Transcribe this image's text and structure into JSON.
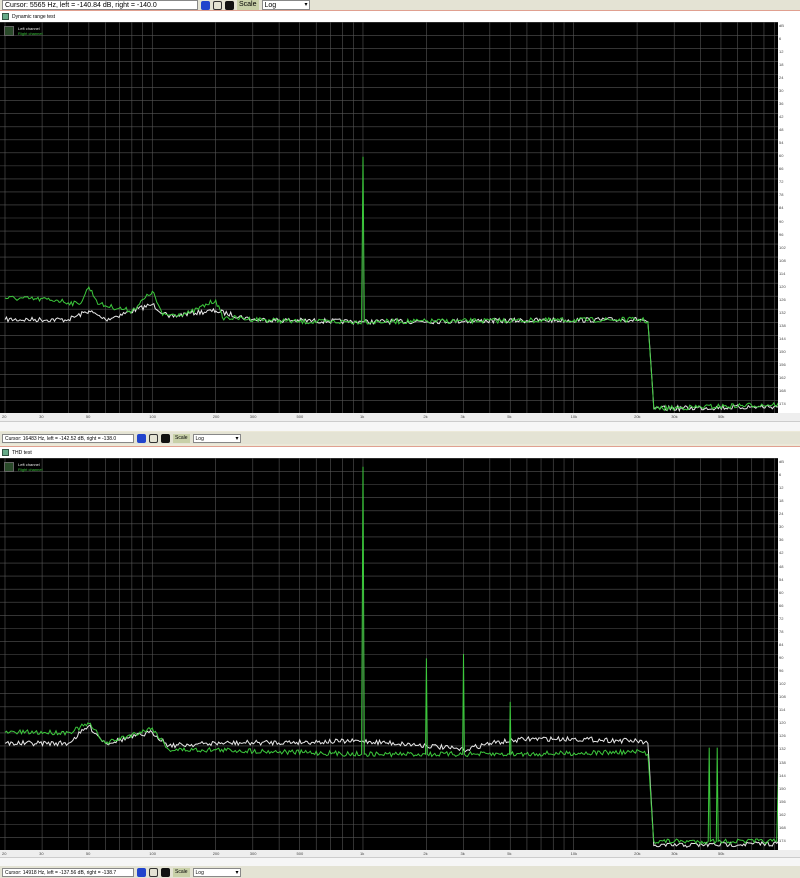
{
  "toolbars": [
    {
      "cursor": "Cursor: 5565 Hz, left = -140.84 dB, right = -140.0",
      "scale_label": "Scale",
      "scale_value": "Log"
    },
    {
      "cursor": "Cursor: 16483 Hz, left = -142.52 dB, right = -138.0",
      "scale_label": "Scale",
      "scale_value": "Log"
    },
    {
      "cursor": "Cursor: 14918 Hz, left = -137.56 dB, right = -138.7",
      "scale_label": "Scale",
      "scale_value": "Log"
    }
  ],
  "colors": {
    "left": "#e8e8e8",
    "right": "#3cc83c",
    "grid": "#555555"
  },
  "chart_data": [
    {
      "type": "line",
      "title": "Dynamic range test",
      "xscale": "log",
      "xlim": [
        20,
        95000
      ],
      "ylim": [
        -180,
        0
      ],
      "x_ticks": [
        {
          "v": 20,
          "l": "20"
        },
        {
          "v": 30,
          "l": "30"
        },
        {
          "v": 50,
          "l": "50"
        },
        {
          "v": 100,
          "l": "100"
        },
        {
          "v": 200,
          "l": "200"
        },
        {
          "v": 300,
          "l": "300"
        },
        {
          "v": 500,
          "l": "500"
        },
        {
          "v": 1000,
          "l": "1k"
        },
        {
          "v": 2000,
          "l": "2k"
        },
        {
          "v": 3000,
          "l": "3k"
        },
        {
          "v": 5000,
          "l": "5k"
        },
        {
          "v": 10000,
          "l": "10k"
        },
        {
          "v": 20000,
          "l": "20k"
        },
        {
          "v": 30000,
          "l": "30k"
        },
        {
          "v": 50000,
          "l": "50k"
        }
      ],
      "y_ticks": [
        "dB",
        "6",
        "12",
        "18",
        "24",
        "30",
        "36",
        "42",
        "48",
        "54",
        "60",
        "66",
        "72",
        "78",
        "84",
        "90",
        "96",
        "102",
        "108",
        "114",
        "120",
        "126",
        "132",
        "138",
        "144",
        "150",
        "156",
        "162",
        "168",
        "174"
      ],
      "legend": [
        "Left channel",
        "Right channel"
      ],
      "series": [
        {
          "name": "Left channel",
          "points": [
            [
              20,
              -137
            ],
            [
              40,
              -137
            ],
            [
              50,
              -133
            ],
            [
              60,
              -137
            ],
            [
              100,
              -130
            ],
            [
              120,
              -136
            ],
            [
              150,
              -134
            ],
            [
              200,
              -133
            ],
            [
              300,
              -137
            ],
            [
              985,
              -138
            ],
            [
              1000,
              -138
            ],
            [
              1015,
              -138
            ],
            [
              21000,
              -137
            ],
            [
              22500,
              -138
            ],
            [
              24000,
              -178
            ],
            [
              95000,
              -177
            ]
          ]
        },
        {
          "name": "Right channel",
          "points": [
            [
              20,
              -127
            ],
            [
              35,
              -128
            ],
            [
              45,
              -130
            ],
            [
              50,
              -122
            ],
            [
              56,
              -130
            ],
            [
              80,
              -133
            ],
            [
              100,
              -124
            ],
            [
              112,
              -135
            ],
            [
              150,
              -134
            ],
            [
              200,
              -128
            ],
            [
              215,
              -136
            ],
            [
              500,
              -138
            ],
            [
              985,
              -138
            ],
            [
              1000,
              -62
            ],
            [
              1015,
              -138
            ],
            [
              21000,
              -137
            ],
            [
              22500,
              -138
            ],
            [
              24000,
              -178
            ],
            [
              95000,
              -176
            ]
          ]
        }
      ]
    },
    {
      "type": "line",
      "title": "THD test",
      "xscale": "log",
      "xlim": [
        20,
        95000
      ],
      "ylim": [
        -180,
        0
      ],
      "x_ticks": [
        {
          "v": 20,
          "l": "20"
        },
        {
          "v": 30,
          "l": "30"
        },
        {
          "v": 50,
          "l": "50"
        },
        {
          "v": 100,
          "l": "100"
        },
        {
          "v": 200,
          "l": "200"
        },
        {
          "v": 300,
          "l": "300"
        },
        {
          "v": 500,
          "l": "500"
        },
        {
          "v": 1000,
          "l": "1k"
        },
        {
          "v": 2000,
          "l": "2k"
        },
        {
          "v": 3000,
          "l": "3k"
        },
        {
          "v": 5000,
          "l": "5k"
        },
        {
          "v": 10000,
          "l": "10k"
        },
        {
          "v": 20000,
          "l": "20k"
        },
        {
          "v": 30000,
          "l": "30k"
        },
        {
          "v": 50000,
          "l": "50k"
        }
      ],
      "y_ticks": [
        "dB",
        "6",
        "12",
        "18",
        "24",
        "30",
        "36",
        "42",
        "48",
        "54",
        "60",
        "66",
        "72",
        "78",
        "84",
        "90",
        "96",
        "102",
        "108",
        "114",
        "120",
        "126",
        "132",
        "138",
        "144",
        "150",
        "156",
        "162",
        "168",
        "174"
      ],
      "legend": [
        "Left channel",
        "Right channel"
      ],
      "series": [
        {
          "name": "Left channel",
          "points": [
            [
              20,
              -131
            ],
            [
              40,
              -131
            ],
            [
              50,
              -123
            ],
            [
              60,
              -131
            ],
            [
              100,
              -126
            ],
            [
              120,
              -132
            ],
            [
              200,
              -131
            ],
            [
              1000,
              -130
            ],
            [
              2000,
              -132
            ],
            [
              3000,
              -134
            ],
            [
              4000,
              -131
            ],
            [
              6000,
              -129
            ],
            [
              10000,
              -129
            ],
            [
              20000,
              -130
            ],
            [
              22500,
              -131
            ],
            [
              24000,
              -178
            ],
            [
              95000,
              -177
            ]
          ]
        },
        {
          "name": "Right channel",
          "points": [
            [
              20,
              -126
            ],
            [
              40,
              -126
            ],
            [
              50,
              -122
            ],
            [
              60,
              -131
            ],
            [
              100,
              -124
            ],
            [
              120,
              -134
            ],
            [
              200,
              -134
            ],
            [
              985,
              -136
            ],
            [
              1000,
              -4
            ],
            [
              1015,
              -136
            ],
            [
              1980,
              -136
            ],
            [
              2000,
              -92
            ],
            [
              2020,
              -136
            ],
            [
              2970,
              -136
            ],
            [
              3000,
              -90
            ],
            [
              3030,
              -136
            ],
            [
              4960,
              -136
            ],
            [
              5000,
              -112
            ],
            [
              5040,
              -136
            ],
            [
              21000,
              -135
            ],
            [
              22500,
              -136
            ],
            [
              24000,
              -176
            ],
            [
              43500,
              -176
            ],
            [
              44000,
              -133
            ],
            [
              44500,
              -176
            ],
            [
              47500,
              -176
            ],
            [
              48000,
              -133
            ],
            [
              48500,
              -176
            ],
            [
              92000,
              -176
            ],
            [
              94000,
              -140
            ],
            [
              95000,
              -175
            ]
          ]
        }
      ]
    }
  ]
}
